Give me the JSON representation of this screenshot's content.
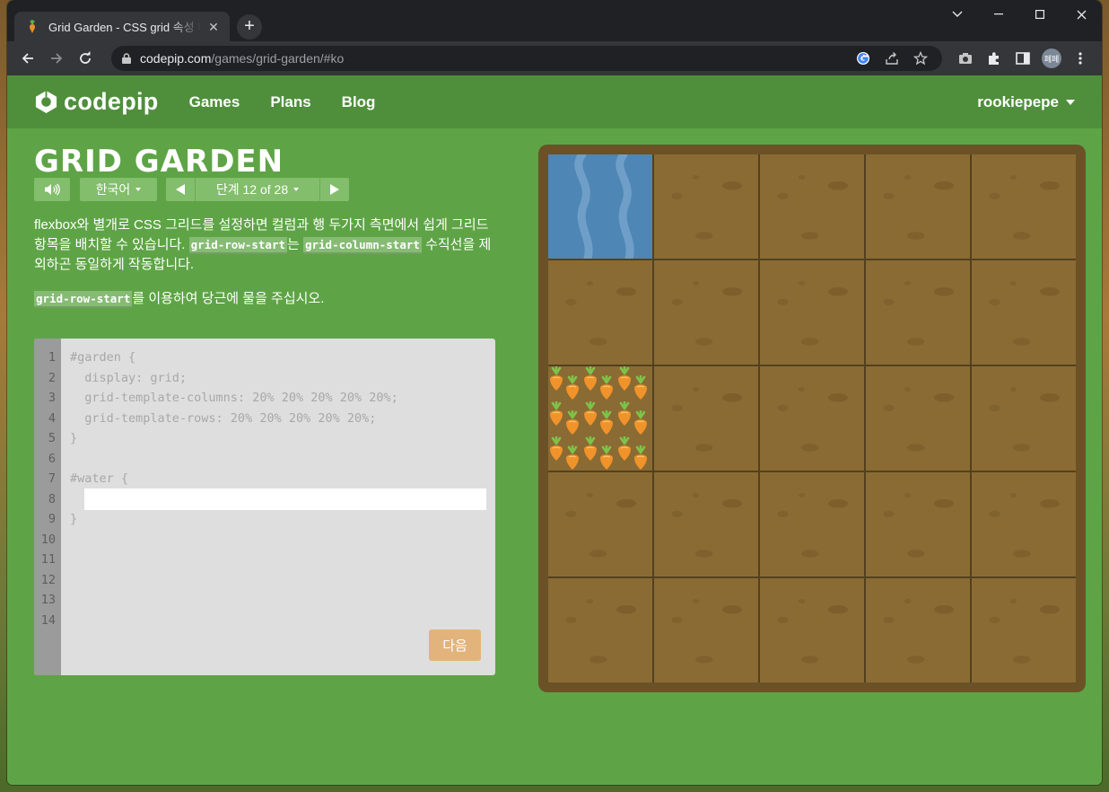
{
  "browser": {
    "tab_title": "Grid Garden - CSS grid 속성 배",
    "url_host": "codepip.com",
    "url_path": "/games/grid-garden/#ko",
    "profile_initials": "페페"
  },
  "site": {
    "logo_text": "codepip",
    "nav": [
      "Games",
      "Plans",
      "Blog"
    ],
    "user": "rookiepepe"
  },
  "game": {
    "title": "GRID GARDEN",
    "language": "한국어",
    "level_label": "단계 12 of 28",
    "instructions_1a": "flexbox와 별개로 CSS 그리드를 설정하면 컬럼과 행 두가지 측면에서 쉽게 그리드 항목을 배치할 수 있습니다. ",
    "instructions_1_code1": "grid-row-start",
    "instructions_1b": "는 ",
    "instructions_1_code2": "grid-column-start",
    "instructions_1c": " 수직선을 제외하곤 동일하게 작동합니다.",
    "instructions_2_code": "grid-row-start",
    "instructions_2": "를 이용하여 당근에 물을 주십시오.",
    "next_label": "다음"
  },
  "editor": {
    "line_numbers": [
      "1",
      "2",
      "3",
      "4",
      "5",
      "6",
      "7",
      "8",
      "9",
      "10",
      "11",
      "12",
      "13",
      "14"
    ],
    "lines": [
      "#garden {",
      "  display: grid;",
      "  grid-template-columns: 20% 20% 20% 20% 20%;",
      "  grid-template-rows: 20% 20% 20% 20% 20%;",
      "}",
      "",
      "#water {",
      "",
      "}",
      "",
      "",
      "",
      "",
      ""
    ],
    "input_value": ""
  },
  "board": {
    "columns": 5,
    "rows": 5,
    "water": {
      "row": 1,
      "column": 1
    },
    "carrots": {
      "row": 3,
      "column": 1
    },
    "colors": {
      "water": "#4e86b5",
      "soil": "#8a6b34",
      "frame": "#6b5226",
      "page": "#5ea446"
    }
  },
  "icons": {
    "sound": "speaker-icon",
    "prev": "triangle-left-icon",
    "next": "triangle-right-icon"
  }
}
